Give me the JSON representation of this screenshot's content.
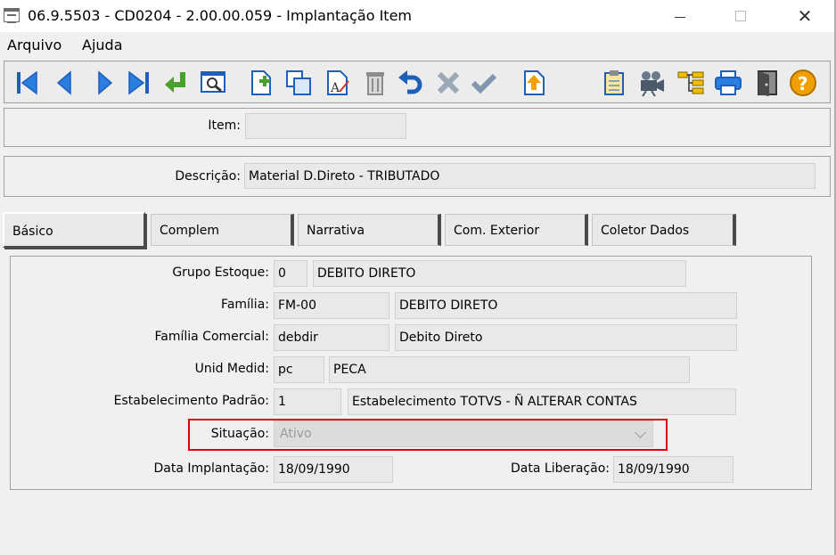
{
  "window": {
    "title": "06.9.5503 - CD0204 - 2.00.00.059 - Implantação Item",
    "minimize_glyph": "—",
    "close_glyph": "✕"
  },
  "menu": {
    "arquivo": "Arquivo",
    "ajuda": "Ajuda"
  },
  "toolbar": {
    "icons": [
      "first-record-icon",
      "previous-record-icon",
      "next-record-icon",
      "last-record-icon",
      "goto-icon",
      "search-icon",
      "new-icon",
      "copy-icon",
      "edit-icon",
      "delete-icon",
      "undo-icon",
      "cancel-icon",
      "confirm-icon",
      "import-icon",
      "clipboard-icon",
      "camera-icon",
      "structure-icon",
      "print-icon",
      "exit-icon",
      "help-icon"
    ],
    "colors": {
      "blue": "#1e5fb8",
      "green": "#4aa02c",
      "orange": "#f0a000",
      "gray": "#8c8c8c"
    }
  },
  "header": {
    "item_label": "Item:",
    "item_value": "",
    "descricao_label": "Descrição:",
    "descricao_value": "Material D.Direto - TRIBUTADO"
  },
  "tabs": [
    {
      "label": "Básico",
      "active": true
    },
    {
      "label": "Complem",
      "active": false
    },
    {
      "label": "Narrativa",
      "active": false
    },
    {
      "label": "Com. Exterior",
      "active": false
    },
    {
      "label": "Coletor Dados",
      "active": false
    }
  ],
  "basico": {
    "grupo_estoque": {
      "label": "Grupo Estoque:",
      "code": "0",
      "desc": "DEBITO DIRETO"
    },
    "familia": {
      "label": "Família:",
      "code": "FM-00",
      "desc": "DEBITO DIRETO"
    },
    "familia_comercial": {
      "label": "Família Comercial:",
      "code": "debdir",
      "desc": "Debito Direto"
    },
    "unid_medid": {
      "label": "Unid Medid:",
      "code": "pc",
      "desc": "PECA"
    },
    "estabelecimento": {
      "label": "Estabelecimento Padrão:",
      "code": "1",
      "desc": "Estabelecimento TOTVS - Ñ ALTERAR CONTAS"
    },
    "situacao": {
      "label": "Situação:",
      "value": "Ativo"
    },
    "data_implantacao": {
      "label": "Data Implantação:",
      "value": "18/09/1990"
    },
    "data_liberacao": {
      "label": "Data Liberação:",
      "value": "18/09/1990"
    }
  },
  "highlight_color": "#e00000"
}
